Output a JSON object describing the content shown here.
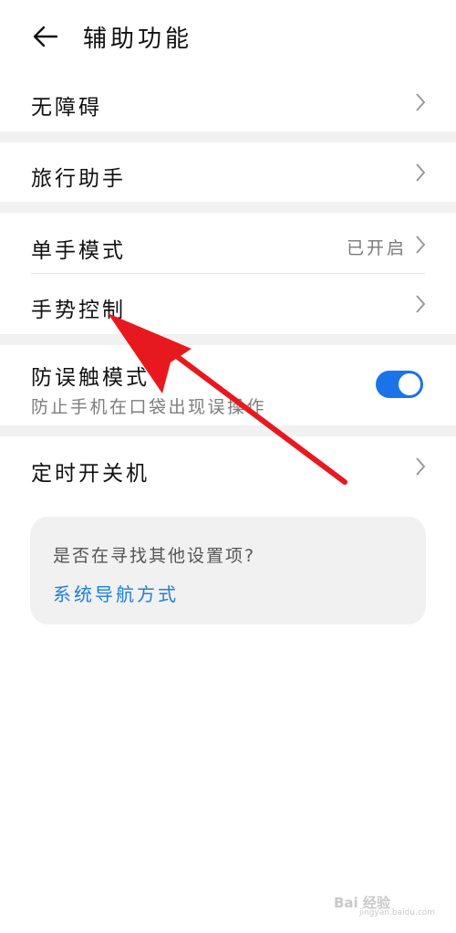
{
  "header": {
    "title": "辅助功能"
  },
  "rows": {
    "accessibility": {
      "label": "无障碍"
    },
    "travel": {
      "label": "旅行助手"
    },
    "one_hand": {
      "label": "单手模式",
      "value": "已开启"
    },
    "gesture": {
      "label": "手势控制"
    },
    "mistouch": {
      "label": "防误触模式",
      "subtext": "防止手机在口袋出现误操作",
      "enabled": true
    },
    "timer_power": {
      "label": "定时开关机"
    }
  },
  "suggestion": {
    "question": "是否在寻找其他设置项?",
    "link": "系统导航方式"
  },
  "watermark": {
    "text": "Bai 经验",
    "sub": "jingyan.baidu.com"
  },
  "colors": {
    "accent": "#1a73e8",
    "link": "#1e7fd6",
    "annotation_arrow": "#e8191e"
  }
}
